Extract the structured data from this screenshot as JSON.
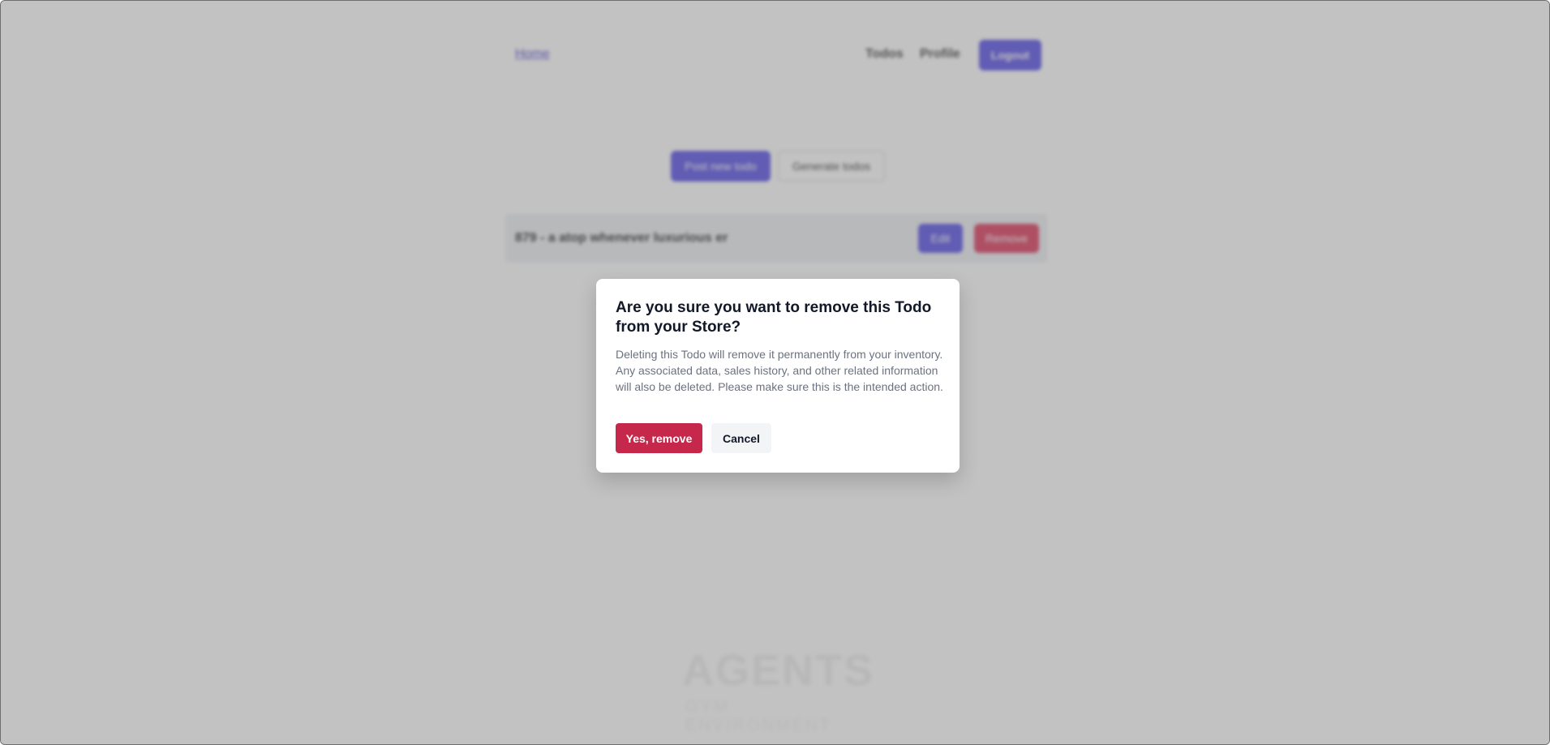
{
  "nav": {
    "home_label": "Home",
    "todos_label": "Todos",
    "profile_label": "Profile",
    "logout_label": "Logout"
  },
  "actions": {
    "post_label": "Post new todo",
    "generate_label": "Generate todos"
  },
  "todo": {
    "text": "879 - a atop whenever luxurious er",
    "edit_label": "Edit",
    "remove_label": "Remove"
  },
  "footer": {
    "logo_text": "AGENTS",
    "logo_sub": "GYM ENVIRONMENT"
  },
  "modal": {
    "title": "Are you sure you want to remove this Todo from your Store?",
    "body": "Deleting this Todo will remove it permanently from your inventory. Any associated data, sales history, and other related information will also be deleted. Please make sure this is the intended action.",
    "confirm_label": "Yes, remove",
    "cancel_label": "Cancel"
  },
  "colors": {
    "primary": "#4f46e5",
    "danger": "#c5284a",
    "overlay": "rgba(120,120,120,0.45)"
  }
}
